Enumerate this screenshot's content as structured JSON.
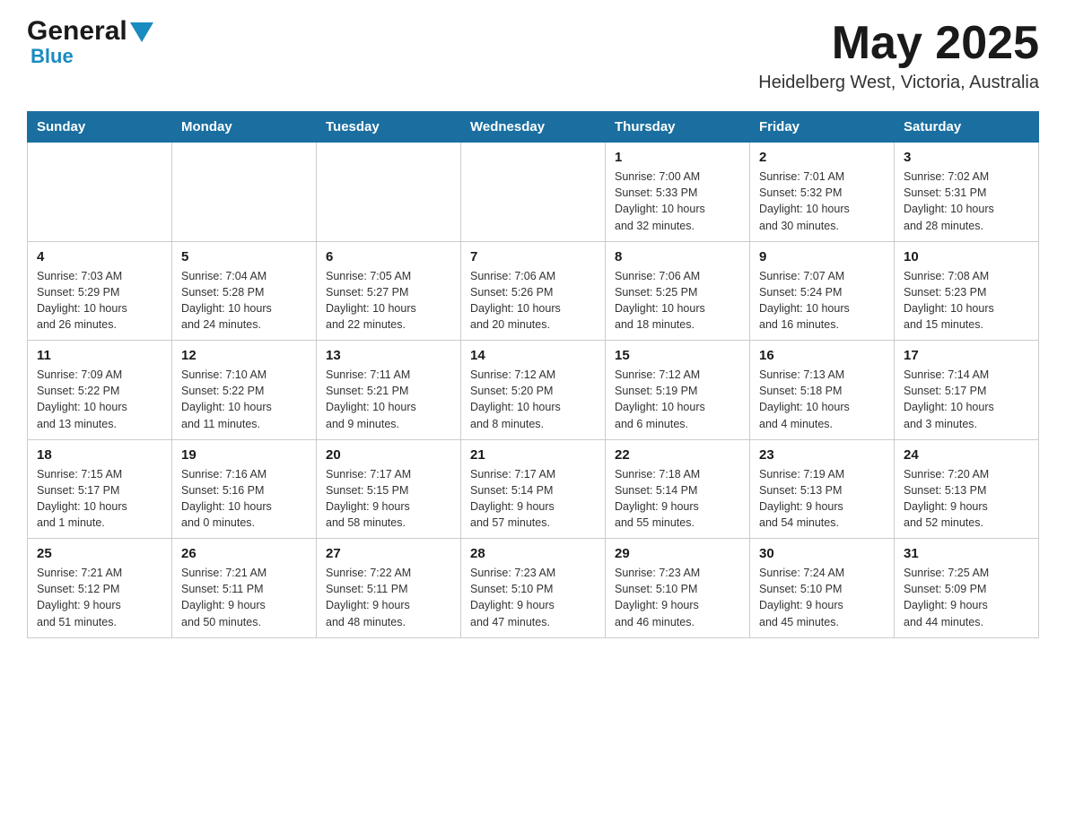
{
  "header": {
    "logo_general": "General",
    "logo_blue": "Blue",
    "month_year": "May 2025",
    "location": "Heidelberg West, Victoria, Australia"
  },
  "days_of_week": [
    "Sunday",
    "Monday",
    "Tuesday",
    "Wednesday",
    "Thursday",
    "Friday",
    "Saturday"
  ],
  "weeks": [
    [
      {
        "day": "",
        "info": ""
      },
      {
        "day": "",
        "info": ""
      },
      {
        "day": "",
        "info": ""
      },
      {
        "day": "",
        "info": ""
      },
      {
        "day": "1",
        "info": "Sunrise: 7:00 AM\nSunset: 5:33 PM\nDaylight: 10 hours\nand 32 minutes."
      },
      {
        "day": "2",
        "info": "Sunrise: 7:01 AM\nSunset: 5:32 PM\nDaylight: 10 hours\nand 30 minutes."
      },
      {
        "day": "3",
        "info": "Sunrise: 7:02 AM\nSunset: 5:31 PM\nDaylight: 10 hours\nand 28 minutes."
      }
    ],
    [
      {
        "day": "4",
        "info": "Sunrise: 7:03 AM\nSunset: 5:29 PM\nDaylight: 10 hours\nand 26 minutes."
      },
      {
        "day": "5",
        "info": "Sunrise: 7:04 AM\nSunset: 5:28 PM\nDaylight: 10 hours\nand 24 minutes."
      },
      {
        "day": "6",
        "info": "Sunrise: 7:05 AM\nSunset: 5:27 PM\nDaylight: 10 hours\nand 22 minutes."
      },
      {
        "day": "7",
        "info": "Sunrise: 7:06 AM\nSunset: 5:26 PM\nDaylight: 10 hours\nand 20 minutes."
      },
      {
        "day": "8",
        "info": "Sunrise: 7:06 AM\nSunset: 5:25 PM\nDaylight: 10 hours\nand 18 minutes."
      },
      {
        "day": "9",
        "info": "Sunrise: 7:07 AM\nSunset: 5:24 PM\nDaylight: 10 hours\nand 16 minutes."
      },
      {
        "day": "10",
        "info": "Sunrise: 7:08 AM\nSunset: 5:23 PM\nDaylight: 10 hours\nand 15 minutes."
      }
    ],
    [
      {
        "day": "11",
        "info": "Sunrise: 7:09 AM\nSunset: 5:22 PM\nDaylight: 10 hours\nand 13 minutes."
      },
      {
        "day": "12",
        "info": "Sunrise: 7:10 AM\nSunset: 5:22 PM\nDaylight: 10 hours\nand 11 minutes."
      },
      {
        "day": "13",
        "info": "Sunrise: 7:11 AM\nSunset: 5:21 PM\nDaylight: 10 hours\nand 9 minutes."
      },
      {
        "day": "14",
        "info": "Sunrise: 7:12 AM\nSunset: 5:20 PM\nDaylight: 10 hours\nand 8 minutes."
      },
      {
        "day": "15",
        "info": "Sunrise: 7:12 AM\nSunset: 5:19 PM\nDaylight: 10 hours\nand 6 minutes."
      },
      {
        "day": "16",
        "info": "Sunrise: 7:13 AM\nSunset: 5:18 PM\nDaylight: 10 hours\nand 4 minutes."
      },
      {
        "day": "17",
        "info": "Sunrise: 7:14 AM\nSunset: 5:17 PM\nDaylight: 10 hours\nand 3 minutes."
      }
    ],
    [
      {
        "day": "18",
        "info": "Sunrise: 7:15 AM\nSunset: 5:17 PM\nDaylight: 10 hours\nand 1 minute."
      },
      {
        "day": "19",
        "info": "Sunrise: 7:16 AM\nSunset: 5:16 PM\nDaylight: 10 hours\nand 0 minutes."
      },
      {
        "day": "20",
        "info": "Sunrise: 7:17 AM\nSunset: 5:15 PM\nDaylight: 9 hours\nand 58 minutes."
      },
      {
        "day": "21",
        "info": "Sunrise: 7:17 AM\nSunset: 5:14 PM\nDaylight: 9 hours\nand 57 minutes."
      },
      {
        "day": "22",
        "info": "Sunrise: 7:18 AM\nSunset: 5:14 PM\nDaylight: 9 hours\nand 55 minutes."
      },
      {
        "day": "23",
        "info": "Sunrise: 7:19 AM\nSunset: 5:13 PM\nDaylight: 9 hours\nand 54 minutes."
      },
      {
        "day": "24",
        "info": "Sunrise: 7:20 AM\nSunset: 5:13 PM\nDaylight: 9 hours\nand 52 minutes."
      }
    ],
    [
      {
        "day": "25",
        "info": "Sunrise: 7:21 AM\nSunset: 5:12 PM\nDaylight: 9 hours\nand 51 minutes."
      },
      {
        "day": "26",
        "info": "Sunrise: 7:21 AM\nSunset: 5:11 PM\nDaylight: 9 hours\nand 50 minutes."
      },
      {
        "day": "27",
        "info": "Sunrise: 7:22 AM\nSunset: 5:11 PM\nDaylight: 9 hours\nand 48 minutes."
      },
      {
        "day": "28",
        "info": "Sunrise: 7:23 AM\nSunset: 5:10 PM\nDaylight: 9 hours\nand 47 minutes."
      },
      {
        "day": "29",
        "info": "Sunrise: 7:23 AM\nSunset: 5:10 PM\nDaylight: 9 hours\nand 46 minutes."
      },
      {
        "day": "30",
        "info": "Sunrise: 7:24 AM\nSunset: 5:10 PM\nDaylight: 9 hours\nand 45 minutes."
      },
      {
        "day": "31",
        "info": "Sunrise: 7:25 AM\nSunset: 5:09 PM\nDaylight: 9 hours\nand 44 minutes."
      }
    ]
  ]
}
